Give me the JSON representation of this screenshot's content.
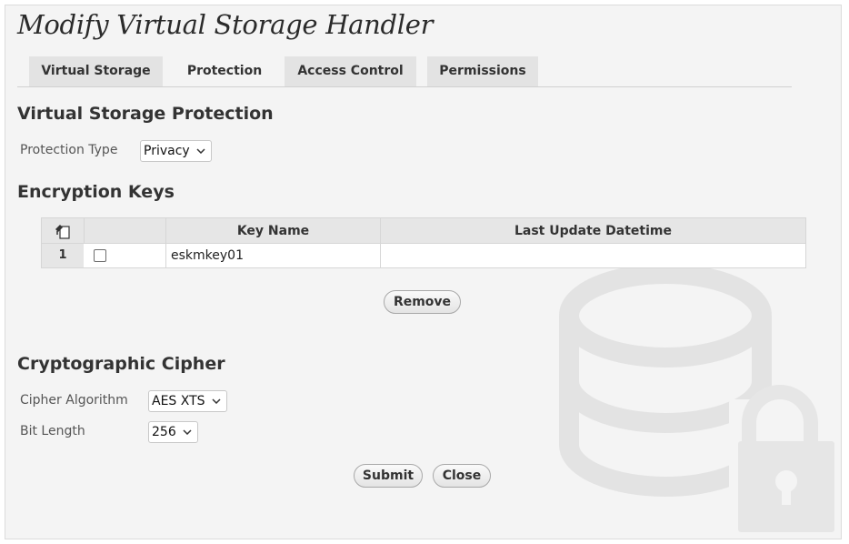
{
  "title": "Modify Virtual Storage Handler",
  "tabs": [
    {
      "label": "Virtual Storage",
      "active": false
    },
    {
      "label": "Protection",
      "active": true
    },
    {
      "label": "Access Control",
      "active": false
    },
    {
      "label": "Permissions",
      "active": false
    }
  ],
  "protection": {
    "heading": "Virtual Storage Protection",
    "type_label": "Protection Type",
    "type_value": "Privacy"
  },
  "keys": {
    "heading": "Encryption Keys",
    "columns": [
      "Key Name",
      "Last Update Datetime"
    ],
    "rows": [
      {
        "index": "1",
        "checked": false,
        "key_name": "eskmkey01",
        "last_update": ""
      }
    ],
    "remove_label": "Remove"
  },
  "cipher": {
    "heading": "Cryptographic Cipher",
    "algorithm_label": "Cipher Algorithm",
    "algorithm_value": "AES XTS",
    "bitlength_label": "Bit Length",
    "bitlength_value": "256"
  },
  "actions": {
    "submit_label": "Submit",
    "close_label": "Close"
  },
  "icons": {
    "header": "column-settings-icon",
    "watermark": "storage-lock-icon"
  },
  "colors": {
    "background": "#f4f4f4",
    "tab": "#e3e3e3",
    "watermark": "#e6e6e6"
  }
}
